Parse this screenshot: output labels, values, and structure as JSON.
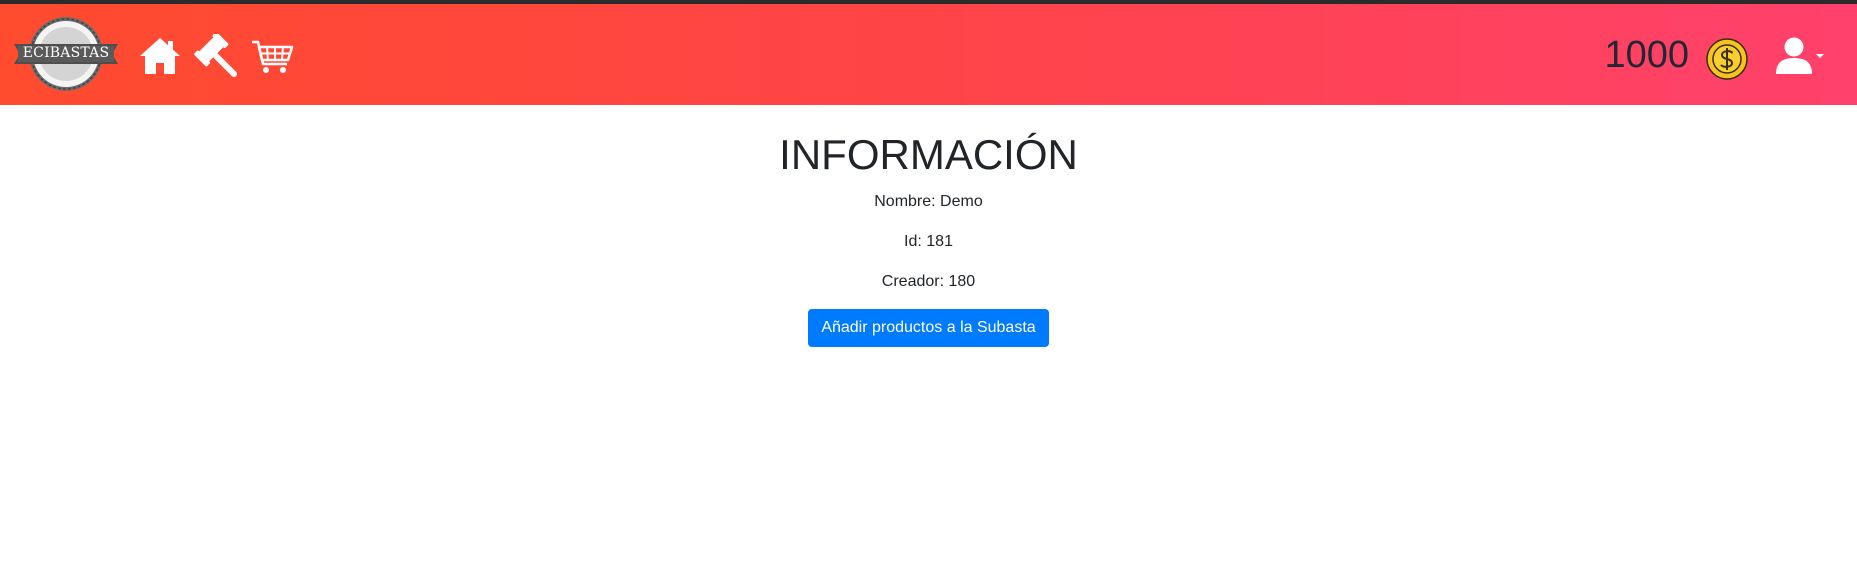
{
  "header": {
    "logo_text": "ECIBASTAS",
    "nav_icons": [
      "home-icon",
      "gavel-icon",
      "cart-icon"
    ],
    "coins_value": "1000",
    "coin_icon": "dollar-coin-icon",
    "user_icon": "user-icon"
  },
  "main": {
    "title": "INFORMACIÓN",
    "nombre": "Nombre: Demo",
    "id": "Id: 181",
    "creador": "Creador: 180",
    "add_button_label": "Añadir productos a la Subasta"
  },
  "colors": {
    "navbar_gradient_start": "#ff4b2e",
    "navbar_gradient_end": "#ff416c",
    "button_primary": "#007bff",
    "text_dark": "#212529"
  }
}
